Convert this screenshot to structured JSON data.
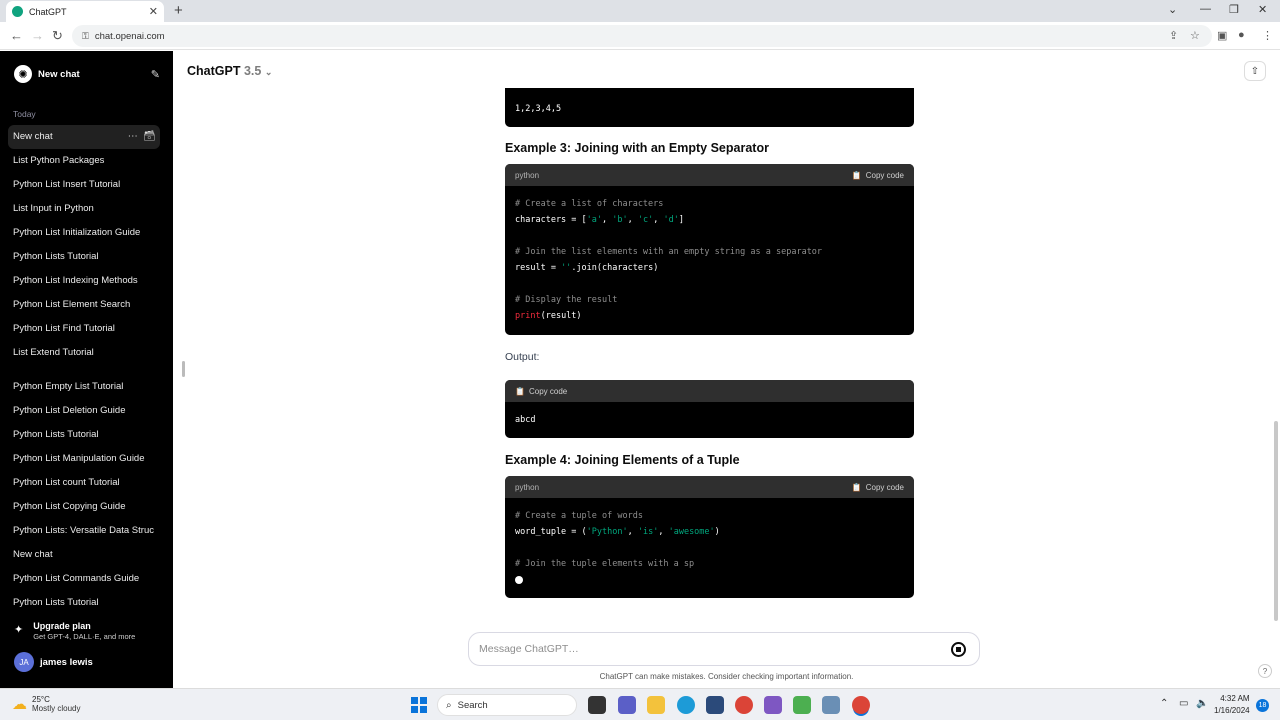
{
  "browser": {
    "tab_title": "ChatGPT",
    "url": "chat.openai.com"
  },
  "sidebar": {
    "new_chat_label": "New chat",
    "section_today": "Today",
    "items": [
      "New chat",
      "List Python Packages",
      "Python List Insert Tutorial",
      "List Input in Python",
      "Python List Initialization Guide",
      "Python Lists Tutorial",
      "Python List Indexing Methods",
      "Python List Element Search",
      "Python List Find Tutorial",
      "List Extend Tutorial",
      "Python Empty List Tutorial",
      "Python List Deletion Guide",
      "Python Lists Tutorial",
      "Python List Manipulation Guide",
      "Python List count Tutorial",
      "Python List Copying Guide",
      "Python Lists: Versatile Data Struc",
      "New chat",
      "Python List Commands Guide",
      "Python Lists Tutorial"
    ],
    "upgrade_title": "Upgrade plan",
    "upgrade_sub": "Get GPT-4, DALL·E, and more",
    "user_initials": "JA",
    "user_name": "james lewis"
  },
  "header": {
    "model_name": "ChatGPT",
    "model_version": "3.5"
  },
  "content": {
    "output1_text": "1,2,3,4,5",
    "example3_heading": "Example 3: Joining with an Empty Separator",
    "example3_lang": "python",
    "copy_label": "Copy code",
    "example3_code": {
      "l1": "# Create a list of characters",
      "l2a": "characters = [",
      "l2s1": "'a'",
      "l2s2": "'b'",
      "l2s3": "'c'",
      "l2s4": "'d'",
      "l3": "# Join the list elements with an empty string as a separator",
      "l4a": "result = ",
      "l4s": "''",
      "l4b": ".join(characters)",
      "l5": "# Display the result",
      "l6a": "print",
      "l6b": "(result)"
    },
    "output_label": "Output:",
    "output2_text": "abcd",
    "example4_heading": "Example 4: Joining Elements of a Tuple",
    "example4_lang": "python",
    "example4_code": {
      "l1": "# Create a tuple of words",
      "l2a": "word_tuple = (",
      "l2s1": "'Python'",
      "l2s2": "'is'",
      "l2s3": "'awesome'",
      "l3": "# Join the tuple elements with a sp"
    }
  },
  "composer": {
    "placeholder": "Message ChatGPT…",
    "disclaimer": "ChatGPT can make mistakes. Consider checking important information."
  },
  "taskbar": {
    "temp": "25°C",
    "weather": "Mostly cloudy",
    "search_label": "Search",
    "time": "4:32 AM",
    "date": "1/16/2024",
    "notif_count": "18"
  }
}
